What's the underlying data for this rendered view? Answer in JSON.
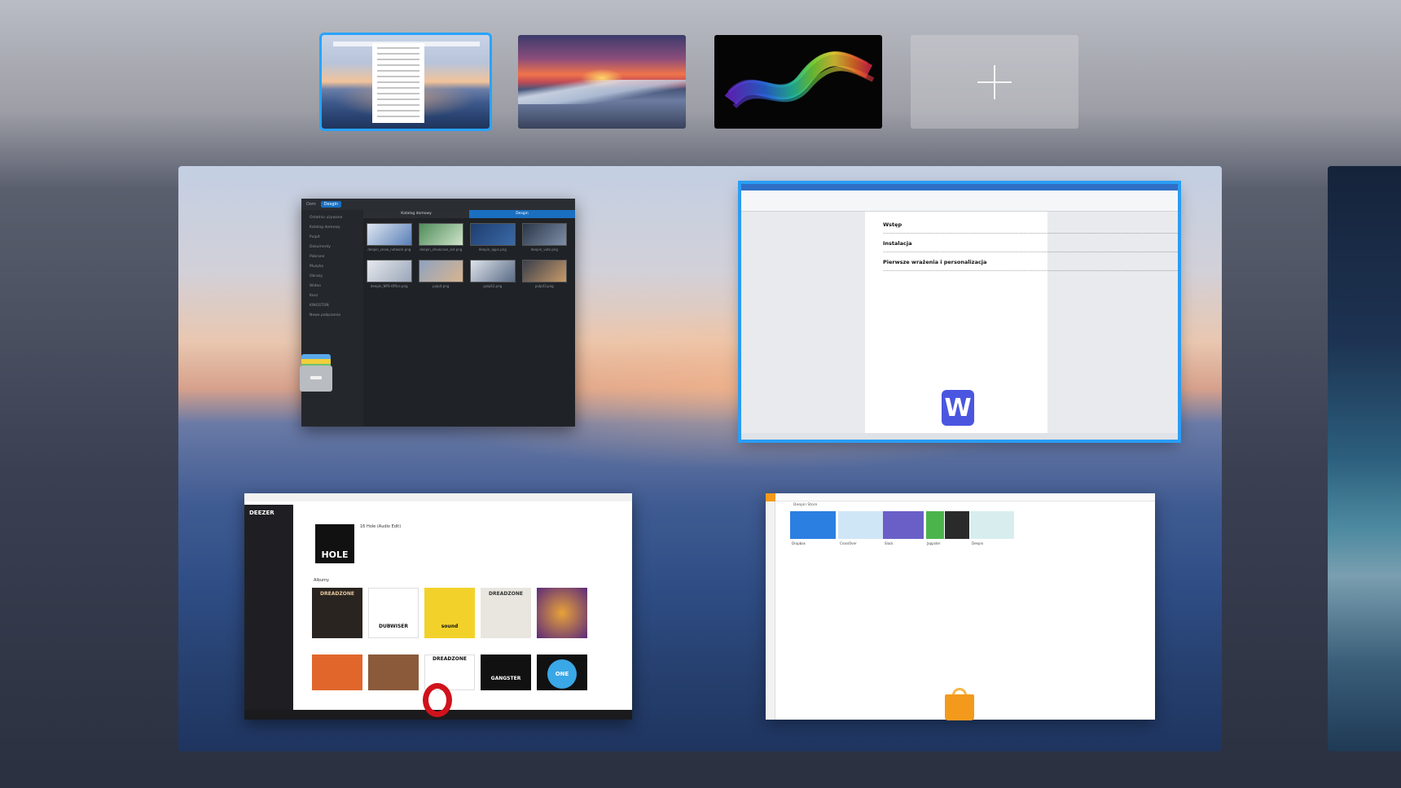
{
  "workspaces": [
    {
      "id": "workspace-1",
      "active": true
    },
    {
      "id": "workspace-2",
      "active": false
    },
    {
      "id": "workspace-3",
      "active": false
    }
  ],
  "add_workspace_icon": "plus-icon",
  "windows": {
    "files": {
      "breadcrumb": [
        "Dom",
        "Desgin"
      ],
      "sidebar": [
        "Ostatnio używane",
        "Katalog domowy",
        "Pulpit",
        "Dokumenty",
        "Pobrane",
        "Muzyka",
        "Obrazy",
        "Wideo",
        "Kosz",
        "KINGSTON",
        "Nowe połączenie"
      ],
      "tabs": [
        "Katalog domowy",
        "Desgin"
      ],
      "files": [
        "deepin_snow_network.png",
        "deepin_showcase_set.png",
        "deepin_apps.png",
        "deepin_vote.png",
        "deepin_NPS-Office.png",
        "pulpit.png",
        "pulpit2.png",
        "pulpit3.png"
      ]
    },
    "writer": {
      "headings": [
        "Wstęp",
        "Instalacja",
        "Pierwsze wrażenia i personalizacja"
      ]
    },
    "deezer": {
      "logo": "DEEZER",
      "hero_artist": "HOLE",
      "hero_title": "16 Hole (Audio Edit)",
      "section": "Albumy",
      "albums": [
        "DREADZONE",
        "DUBWISER",
        "sound",
        "DREADZONE",
        "",
        "",
        "",
        "DREADZONE",
        "GANGSTER",
        "ONE"
      ]
    },
    "store": {
      "heading": "Deepin Store",
      "apps": [
        "Dropbox",
        "CrossOver",
        "Slack",
        "Jappster",
        "",
        "Deepin"
      ]
    }
  },
  "colors": {
    "accent": "#2a9df4",
    "deepin_wps": "#4a56e0",
    "opera_red": "#d0121c",
    "store_orange": "#f39a1c"
  }
}
